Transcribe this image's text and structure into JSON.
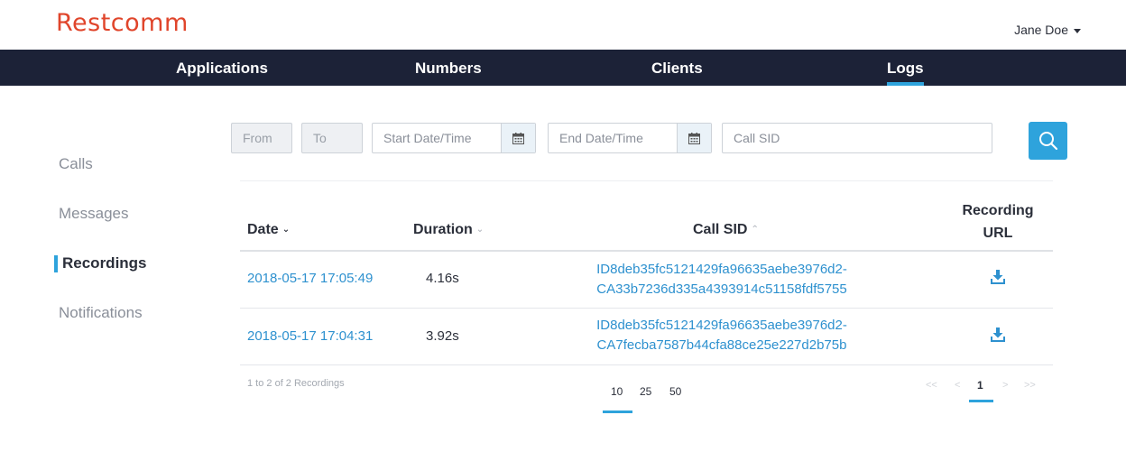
{
  "header": {
    "logo": "Restcomm",
    "user_name": "Jane Doe"
  },
  "nav": {
    "items": [
      "Applications",
      "Numbers",
      "Clients",
      "Logs"
    ],
    "active": "Logs"
  },
  "sidebar": {
    "items": [
      "Calls",
      "Messages",
      "Recordings",
      "Notifications"
    ],
    "active": "Recordings"
  },
  "filters": {
    "from_label": "From",
    "to_label": "To",
    "start_placeholder": "Start Date/Time",
    "end_placeholder": "End Date/Time",
    "sid_placeholder": "Call SID"
  },
  "table": {
    "headers": {
      "date": "Date",
      "duration": "Duration",
      "call_sid": "Call SID",
      "recording_url_1": "Recording",
      "recording_url_2": "URL"
    },
    "rows": [
      {
        "date": "2018-05-17 17:05:49",
        "duration": "4.16s",
        "sid_line1": "ID8deb35fc5121429fa96635aebe3976d2-",
        "sid_line2": "CA33b7236d335a4393914c51158fdf5755"
      },
      {
        "date": "2018-05-17 17:04:31",
        "duration": "3.92s",
        "sid_line1": "ID8deb35fc5121429fa96635aebe3976d2-",
        "sid_line2": "CA7fecba7587b44cfa88ce25e227d2b75b"
      }
    ]
  },
  "footer": {
    "count_text": "1 to 2 of 2 Recordings",
    "page_sizes": [
      "10",
      "25",
      "50"
    ],
    "selected_page_size": "10",
    "pager": {
      "first": "<<",
      "prev": "<",
      "current": "1",
      "next": ">",
      "last": ">>"
    }
  },
  "colors": {
    "brand": "#e0452b",
    "nav_bg": "#1c2237",
    "accent": "#2ea3dc",
    "link": "#2e91cf"
  }
}
